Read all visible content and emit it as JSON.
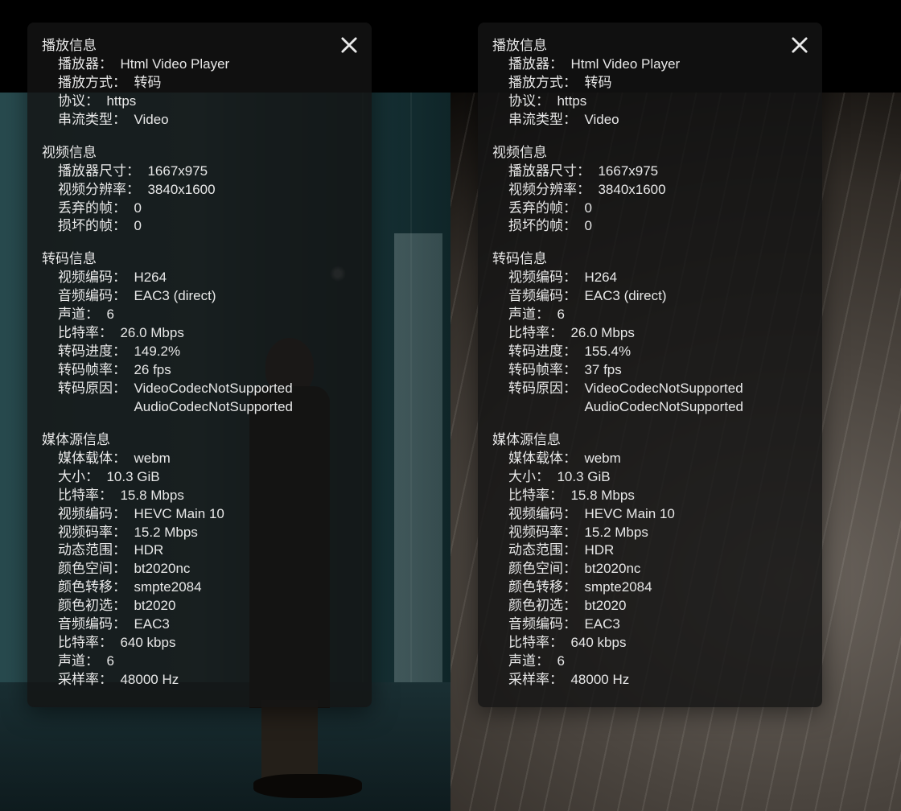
{
  "panels": [
    {
      "sections": [
        {
          "title": "播放信息",
          "rows": [
            {
              "label": "播放器",
              "value": "Html Video Player"
            },
            {
              "label": "播放方式",
              "value": "转码"
            },
            {
              "label": "协议",
              "value": "https"
            },
            {
              "label": "串流类型",
              "value": "Video"
            }
          ]
        },
        {
          "title": "视频信息",
          "rows": [
            {
              "label": "播放器尺寸",
              "value": "1667x975"
            },
            {
              "label": "视频分辨率",
              "value": "3840x1600"
            },
            {
              "label": "丢弃的帧",
              "value": "0"
            },
            {
              "label": "损坏的帧",
              "value": "0"
            }
          ]
        },
        {
          "title": "转码信息",
          "rows": [
            {
              "label": "视频编码",
              "value": "H264"
            },
            {
              "label": "音频编码",
              "value": "EAC3 (direct)"
            },
            {
              "label": "声道",
              "value": "6"
            },
            {
              "label": "比特率",
              "value": "26.0 Mbps"
            },
            {
              "label": "转码进度",
              "value": "149.2%"
            },
            {
              "label": "转码帧率",
              "value": "26 fps"
            },
            {
              "label": "转码原因",
              "value": "VideoCodecNotSupported",
              "extra": "AudioCodecNotSupported"
            }
          ]
        },
        {
          "title": "媒体源信息",
          "rows": [
            {
              "label": "媒体载体",
              "value": "webm"
            },
            {
              "label": "大小",
              "value": "10.3 GiB"
            },
            {
              "label": "比特率",
              "value": "15.8 Mbps"
            },
            {
              "label": "视频编码",
              "value": "HEVC Main 10"
            },
            {
              "label": "视频码率",
              "value": "15.2 Mbps"
            },
            {
              "label": "动态范围",
              "value": "HDR"
            },
            {
              "label": "颜色空间",
              "value": "bt2020nc"
            },
            {
              "label": "颜色转移",
              "value": "smpte2084"
            },
            {
              "label": "颜色初选",
              "value": "bt2020"
            },
            {
              "label": "音频编码",
              "value": "EAC3"
            },
            {
              "label": "比特率",
              "value": "640 kbps"
            },
            {
              "label": "声道",
              "value": "6"
            },
            {
              "label": "采样率",
              "value": "48000 Hz"
            }
          ]
        }
      ]
    },
    {
      "sections": [
        {
          "title": "播放信息",
          "rows": [
            {
              "label": "播放器",
              "value": "Html Video Player"
            },
            {
              "label": "播放方式",
              "value": "转码"
            },
            {
              "label": "协议",
              "value": "https"
            },
            {
              "label": "串流类型",
              "value": "Video"
            }
          ]
        },
        {
          "title": "视频信息",
          "rows": [
            {
              "label": "播放器尺寸",
              "value": "1667x975"
            },
            {
              "label": "视频分辨率",
              "value": "3840x1600"
            },
            {
              "label": "丢弃的帧",
              "value": "0"
            },
            {
              "label": "损坏的帧",
              "value": "0"
            }
          ]
        },
        {
          "title": "转码信息",
          "rows": [
            {
              "label": "视频编码",
              "value": "H264"
            },
            {
              "label": "音频编码",
              "value": "EAC3 (direct)"
            },
            {
              "label": "声道",
              "value": "6"
            },
            {
              "label": "比特率",
              "value": "26.0 Mbps"
            },
            {
              "label": "转码进度",
              "value": "155.4%"
            },
            {
              "label": "转码帧率",
              "value": "37 fps"
            },
            {
              "label": "转码原因",
              "value": "VideoCodecNotSupported",
              "extra": "AudioCodecNotSupported"
            }
          ]
        },
        {
          "title": "媒体源信息",
          "rows": [
            {
              "label": "媒体载体",
              "value": "webm"
            },
            {
              "label": "大小",
              "value": "10.3 GiB"
            },
            {
              "label": "比特率",
              "value": "15.8 Mbps"
            },
            {
              "label": "视频编码",
              "value": "HEVC Main 10"
            },
            {
              "label": "视频码率",
              "value": "15.2 Mbps"
            },
            {
              "label": "动态范围",
              "value": "HDR"
            },
            {
              "label": "颜色空间",
              "value": "bt2020nc"
            },
            {
              "label": "颜色转移",
              "value": "smpte2084"
            },
            {
              "label": "颜色初选",
              "value": "bt2020"
            },
            {
              "label": "音频编码",
              "value": "EAC3"
            },
            {
              "label": "比特率",
              "value": "640 kbps"
            },
            {
              "label": "声道",
              "value": "6"
            },
            {
              "label": "采样率",
              "value": "48000 Hz"
            }
          ]
        }
      ]
    }
  ]
}
